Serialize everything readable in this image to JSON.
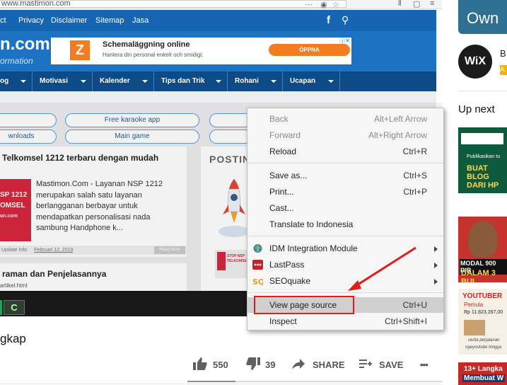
{
  "browser": {
    "url": "www.mastimon.com"
  },
  "site": {
    "nav_items": [
      "ct",
      "Privacy",
      "Disclaimer",
      "Sitemap",
      "Jasa"
    ],
    "logo": "n.com",
    "tagline": "ormation",
    "ad": {
      "logo_letter": "Z",
      "title": "Schemaläggning online",
      "subtitle": "Hantera din personal enkelt och smidigt.",
      "button": "ÖPPNA"
    },
    "menu": [
      "og",
      "Motivasi",
      "Kalender",
      "Tips dan Trik",
      "Rohani",
      "Ucapan"
    ],
    "pills_row1": [
      "Free karaoke app"
    ],
    "pills_row2": [
      "wnloads",
      "Main game"
    ],
    "post_title": "Telkomsel 1212 terbaru dengan mudah",
    "thumb_text": [
      "SP 1212",
      "OMSEL",
      "on.com"
    ],
    "excerpt": "Mastimon.Com - Layanan NSP 1212 merupakan salah satu layanan berlangganan berbayar untuk mendapatkan personalisasi nada sambung Handphone k...",
    "meta": "Update Info",
    "meta_date": "Februari 12, 2019",
    "read_more": "Read More",
    "postin": "POSTIN",
    "post2_title": "raman dan Penjelasannya",
    "post2_url": "artikel.html",
    "stop_thumb": "STOP NSP TELKOMSEL",
    "taskbar_icon": "C"
  },
  "context_menu": {
    "group1": [
      {
        "label": "Back",
        "shortcut": "Alt+Left Arrow",
        "disabled": true
      },
      {
        "label": "Forward",
        "shortcut": "Alt+Right Arrow",
        "disabled": true
      },
      {
        "label": "Reload",
        "shortcut": "Ctrl+R",
        "disabled": false
      }
    ],
    "group2": [
      {
        "label": "Save as...",
        "shortcut": "Ctrl+S"
      },
      {
        "label": "Print...",
        "shortcut": "Ctrl+P"
      },
      {
        "label": "Cast...",
        "shortcut": ""
      },
      {
        "label": "Translate to Indonesia",
        "shortcut": ""
      }
    ],
    "group3": [
      {
        "label": "IDM Integration Module",
        "icon": "idm-icon",
        "submenu": true
      },
      {
        "label": "LastPass",
        "icon": "lastpass-icon",
        "submenu": true
      },
      {
        "label": "SEOquake",
        "icon": "seoquake-icon",
        "submenu": true
      }
    ],
    "group4": [
      {
        "label": "View page source",
        "shortcut": "Ctrl+U",
        "highlighted": true
      },
      {
        "label": "Inspect",
        "shortcut": "Ctrl+Shift+I"
      }
    ]
  },
  "annotation": {
    "highlight_color": "#e21b1b"
  },
  "video": {
    "title_fragment": "gkap",
    "likes": "550",
    "dislikes": "39",
    "share_label": "SHARE",
    "save_label": "SAVE",
    "more_label": "•••",
    "progress_fraction": 0.19
  },
  "sidebar": {
    "ad_text": "Own",
    "channel_logo": "WiX",
    "channel_initial": "B",
    "badge": "A",
    "up_next": "Up next",
    "thumbs": [
      {
        "lines": [
          "Publikasikan tu",
          "BUAT",
          "BLOG",
          "DARI HP"
        ]
      },
      {
        "lines": [
          "MODAL 900 RIB",
          "DALAM 3 BUL"
        ]
      },
      {
        "lines": [
          "YOUTUBER",
          "Pemula",
          "Rp 11.823.267,00",
          "cerita perjalanan",
          "ngeyoutube hingga"
        ]
      },
      {
        "lines": [
          "13+ Langka",
          "Membuat W"
        ]
      }
    ]
  }
}
